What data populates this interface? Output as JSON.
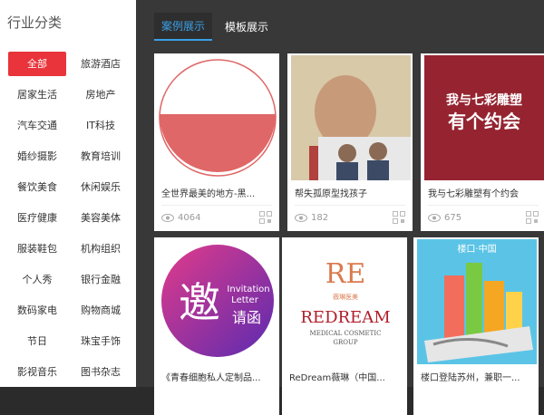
{
  "sidebar": {
    "title": "行业分类",
    "categories": [
      "全部",
      "旅游酒店",
      "居家生活",
      "房地产",
      "汽车交通",
      "IT科技",
      "婚纱摄影",
      "教育培训",
      "餐饮美食",
      "休闲娱乐",
      "医疗健康",
      "美容美体",
      "服装鞋包",
      "机构组织",
      "个人秀",
      "银行金融",
      "数码家电",
      "购物商城",
      "节日",
      "珠宝手饰",
      "影视音乐",
      "图书杂志"
    ],
    "active_index": 0
  },
  "tabs": [
    "案例展示",
    "模板展示"
  ],
  "active_tab": 0,
  "cards": [
    {
      "title": "全世界最美的地方-黑...",
      "views": "4064",
      "thumb_icon": "pie-circle-image"
    },
    {
      "title": "帮失孤原型找孩子",
      "views": "182",
      "thumb_icon": "child-photo-image"
    },
    {
      "title": "我与七彩雕塑有个约会",
      "views": "675",
      "thumb_icon": "banner-image",
      "thumb_text": [
        "我与七彩雕塑",
        "有个约会"
      ]
    },
    {
      "title": "《青春细胞私人定制品...",
      "views": "",
      "thumb_icon": "invitation-image",
      "thumb_text": [
        "邀",
        "Invitation",
        "Letter",
        "请函"
      ]
    },
    {
      "title": "ReDream薇琳（中国...",
      "views": "",
      "thumb_icon": "redream-logo-image",
      "thumb_text": [
        "RE",
        "薇琳医美",
        "REDREAM",
        "MEDICAL COSMETIC",
        "GROUP"
      ]
    },
    {
      "title": "楼口登陆苏州，兼职一...",
      "views": "",
      "thumb_icon": "city-phone-image",
      "thumb_text": [
        "楼口·中国"
      ]
    }
  ],
  "colors": {
    "accent_red": "#e8343a",
    "tab_blue": "#3ba0e8"
  }
}
